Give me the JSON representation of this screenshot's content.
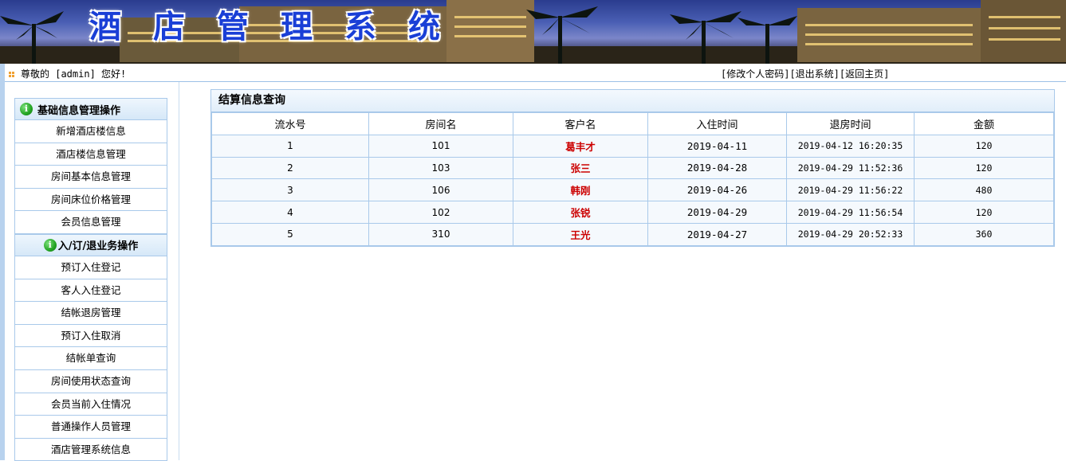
{
  "banner": {
    "title_chars": [
      "酒",
      "店",
      "管",
      "理",
      "系",
      "统"
    ]
  },
  "topbar": {
    "welcome": "尊敬的 [admin] 您好!",
    "links": [
      "[修改个人密码]",
      "[退出系统]",
      "[返回主页]"
    ]
  },
  "sidebar": {
    "section1": "基础信息管理操作",
    "section1_items": [
      "新增酒店楼信息",
      "酒店楼信息管理",
      "房间基本信息管理",
      "房间床位价格管理",
      "会员信息管理"
    ],
    "section2": "入/订/退业务操作",
    "section2_items": [
      "预订入住登记",
      "客人入住登记",
      "结帐退房管理",
      "预订入住取消",
      "结帐单查询",
      "房间使用状态查询",
      "会员当前入住情况",
      "普通操作人员管理",
      "酒店管理系统信息"
    ]
  },
  "panel": {
    "title": "结算信息查询",
    "columns": [
      "流水号",
      "房间名",
      "客户名",
      "入住时间",
      "退房时间",
      "金额"
    ],
    "rows": [
      [
        "1",
        "101",
        "葛丰才",
        "2019-04-11",
        "2019-04-12 16:20:35",
        "120"
      ],
      [
        "2",
        "103",
        "张三",
        "2019-04-28",
        "2019-04-29 11:52:36",
        "120"
      ],
      [
        "3",
        "106",
        "韩刚",
        "2019-04-26",
        "2019-04-29 11:56:22",
        "480"
      ],
      [
        "4",
        "102",
        "张锐",
        "2019-04-29",
        "2019-04-29 11:56:54",
        "120"
      ],
      [
        "5",
        "310",
        "王光",
        "2019-04-27",
        "2019-04-29 20:52:33",
        "360"
      ]
    ]
  },
  "colors": {
    "accent_border": "#a9c9ea",
    "guest_name": "#cc0000",
    "title_blue": "#1a3fd6"
  }
}
